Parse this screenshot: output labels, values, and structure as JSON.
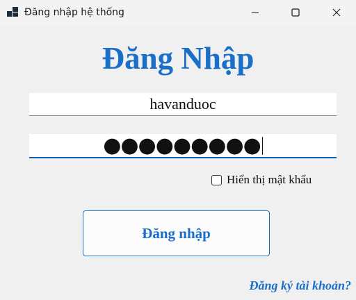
{
  "window": {
    "title": "Đăng nhập hệ thống",
    "app_icon": "app-window-icon",
    "controls": [
      "minimize-icon",
      "maximize-icon",
      "close-icon"
    ]
  },
  "form": {
    "heading": "Đăng Nhập",
    "username_value": "havanduoc",
    "password_masked": "●●●●●●●●●",
    "show_password_label": "Hiển thị mật khẩu",
    "show_password_checked": false,
    "login_button": "Đăng nhập",
    "register_link": "Đăng ký tài khoản?"
  },
  "colors": {
    "accent": "#1a6fc9",
    "background": "#f0f0f0"
  }
}
